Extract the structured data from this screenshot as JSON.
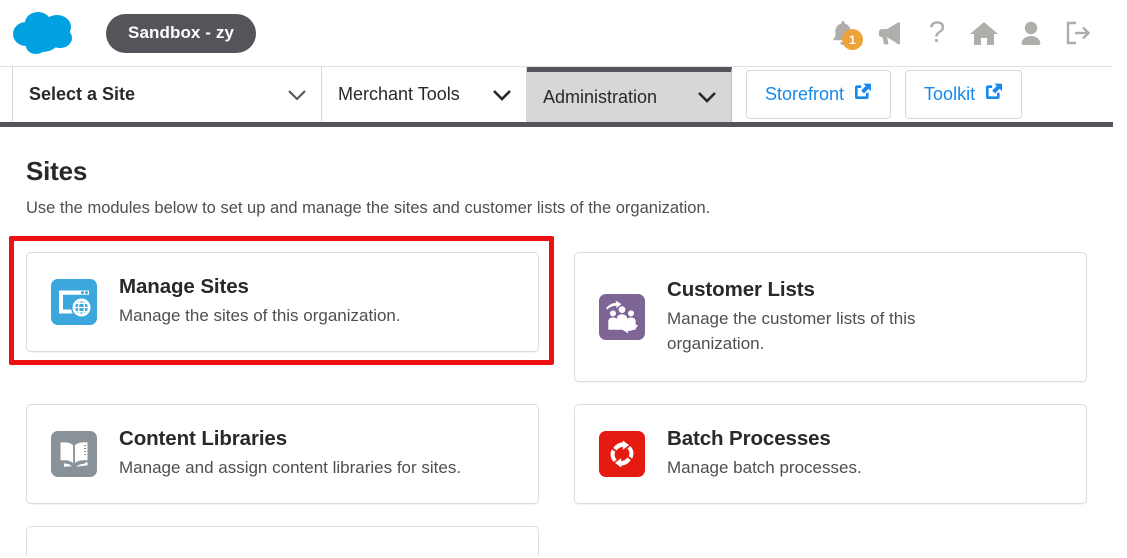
{
  "topbar": {
    "logo_name": "salesforce-cloud-logo",
    "sandbox_label": "Sandbox - zy",
    "icons": [
      {
        "name": "notifications-bell-icon",
        "badge": "1"
      },
      {
        "name": "megaphone-icon"
      },
      {
        "name": "help-question-icon",
        "glyph": "?"
      },
      {
        "name": "home-icon"
      },
      {
        "name": "user-profile-icon"
      },
      {
        "name": "logout-icon"
      }
    ]
  },
  "nav": {
    "tabs": [
      {
        "label": "Select a Site",
        "active": false,
        "bold": true
      },
      {
        "label": "Merchant Tools",
        "active": false,
        "bold": false
      },
      {
        "label": "Administration",
        "active": true,
        "bold": false
      }
    ],
    "buttons": [
      {
        "label": "Storefront",
        "icon": "external-link-icon"
      },
      {
        "label": "Toolkit",
        "icon": "external-link-icon"
      }
    ]
  },
  "page": {
    "title": "Sites",
    "subtitle": "Use the modules below to set up and manage the sites and customer lists of the organization."
  },
  "modules": [
    {
      "title": "Manage Sites",
      "description": "Manage the sites of this organization.",
      "icon": "manage-sites-icon",
      "icon_color": "#3ba7dd",
      "highlighted": true
    },
    {
      "title": "Customer Lists",
      "description": "Manage the customer lists of this organization.",
      "icon": "customer-lists-icon",
      "icon_color": "#7d6596",
      "highlighted": false
    },
    {
      "title": "Content Libraries",
      "description": "Manage and assign content libraries for sites.",
      "icon": "content-libraries-icon",
      "icon_color": "#8a9299",
      "highlighted": false
    },
    {
      "title": "Batch Processes",
      "description": "Manage batch processes.",
      "icon": "batch-processes-icon",
      "icon_color": "#e51b12",
      "highlighted": false
    }
  ],
  "colors": {
    "accent_blue": "#1589ee",
    "highlight_red": "#ee1111",
    "badge_orange": "#eda23a",
    "dark_bar": "#54545a",
    "active_tab_bg": "#d7d7d7"
  }
}
